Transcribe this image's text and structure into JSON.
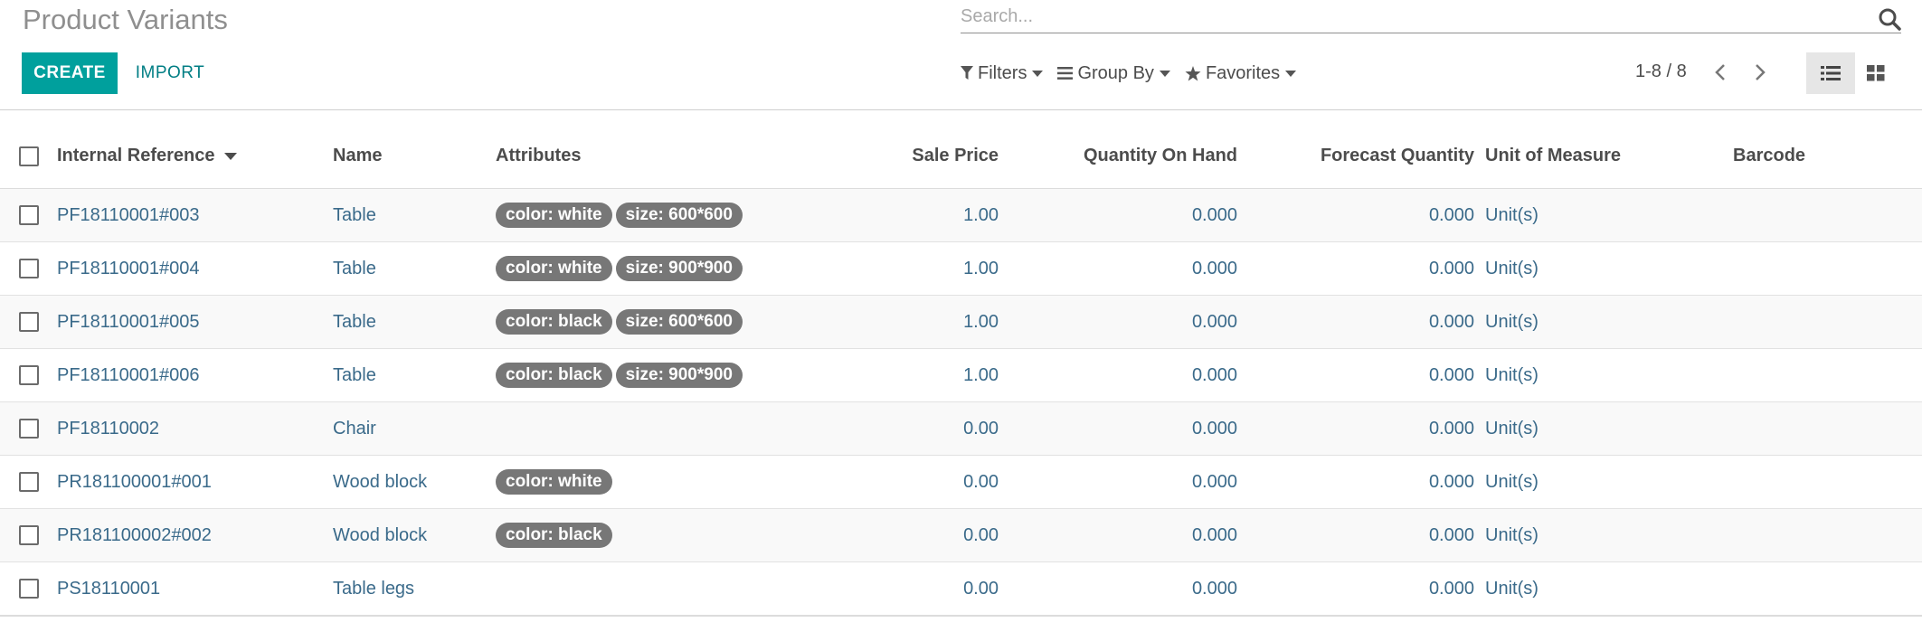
{
  "page": {
    "title": "Product Variants"
  },
  "search": {
    "placeholder": "Search..."
  },
  "buttons": {
    "create": "CREATE",
    "import": "IMPORT"
  },
  "search_options": {
    "filters": "Filters",
    "group_by": "Group By",
    "favorites": "Favorites"
  },
  "pager": {
    "text": "1-8 / 8"
  },
  "colors": {
    "accent": "#00a09d",
    "link": "#017e84",
    "tag_bg": "#777777",
    "row_text": "#3a6a8a"
  },
  "icons": [
    "search-icon",
    "filter-icon",
    "group-by-icon",
    "star-icon",
    "chevron-left-icon",
    "chevron-right-icon",
    "list-view-icon",
    "kanban-view-icon"
  ],
  "table": {
    "columns": {
      "internal_reference": "Internal Reference",
      "name": "Name",
      "attributes": "Attributes",
      "sale_price": "Sale Price",
      "quantity_on_hand": "Quantity On Hand",
      "forecast_quantity": "Forecast Quantity",
      "unit_of_measure": "Unit of Measure",
      "barcode": "Barcode"
    },
    "rows": [
      {
        "ref": "PF18110001#003",
        "name": "Table",
        "tags": [
          "color: white",
          "size: 600*600"
        ],
        "price": "1.00",
        "qty": "0.000",
        "forecast": "0.000",
        "uom": "Unit(s)",
        "barcode": ""
      },
      {
        "ref": "PF18110001#004",
        "name": "Table",
        "tags": [
          "color: white",
          "size: 900*900"
        ],
        "price": "1.00",
        "qty": "0.000",
        "forecast": "0.000",
        "uom": "Unit(s)",
        "barcode": ""
      },
      {
        "ref": "PF18110001#005",
        "name": "Table",
        "tags": [
          "color: black",
          "size: 600*600"
        ],
        "price": "1.00",
        "qty": "0.000",
        "forecast": "0.000",
        "uom": "Unit(s)",
        "barcode": ""
      },
      {
        "ref": "PF18110001#006",
        "name": "Table",
        "tags": [
          "color: black",
          "size: 900*900"
        ],
        "price": "1.00",
        "qty": "0.000",
        "forecast": "0.000",
        "uom": "Unit(s)",
        "barcode": ""
      },
      {
        "ref": "PF18110002",
        "name": "Chair",
        "tags": [],
        "price": "0.00",
        "qty": "0.000",
        "forecast": "0.000",
        "uom": "Unit(s)",
        "barcode": ""
      },
      {
        "ref": "PR181100001#001",
        "name": "Wood block",
        "tags": [
          "color: white"
        ],
        "price": "0.00",
        "qty": "0.000",
        "forecast": "0.000",
        "uom": "Unit(s)",
        "barcode": ""
      },
      {
        "ref": "PR181100002#002",
        "name": "Wood block",
        "tags": [
          "color: black"
        ],
        "price": "0.00",
        "qty": "0.000",
        "forecast": "0.000",
        "uom": "Unit(s)",
        "barcode": ""
      },
      {
        "ref": "PS18110001",
        "name": "Table legs",
        "tags": [],
        "price": "0.00",
        "qty": "0.000",
        "forecast": "0.000",
        "uom": "Unit(s)",
        "barcode": ""
      }
    ]
  }
}
